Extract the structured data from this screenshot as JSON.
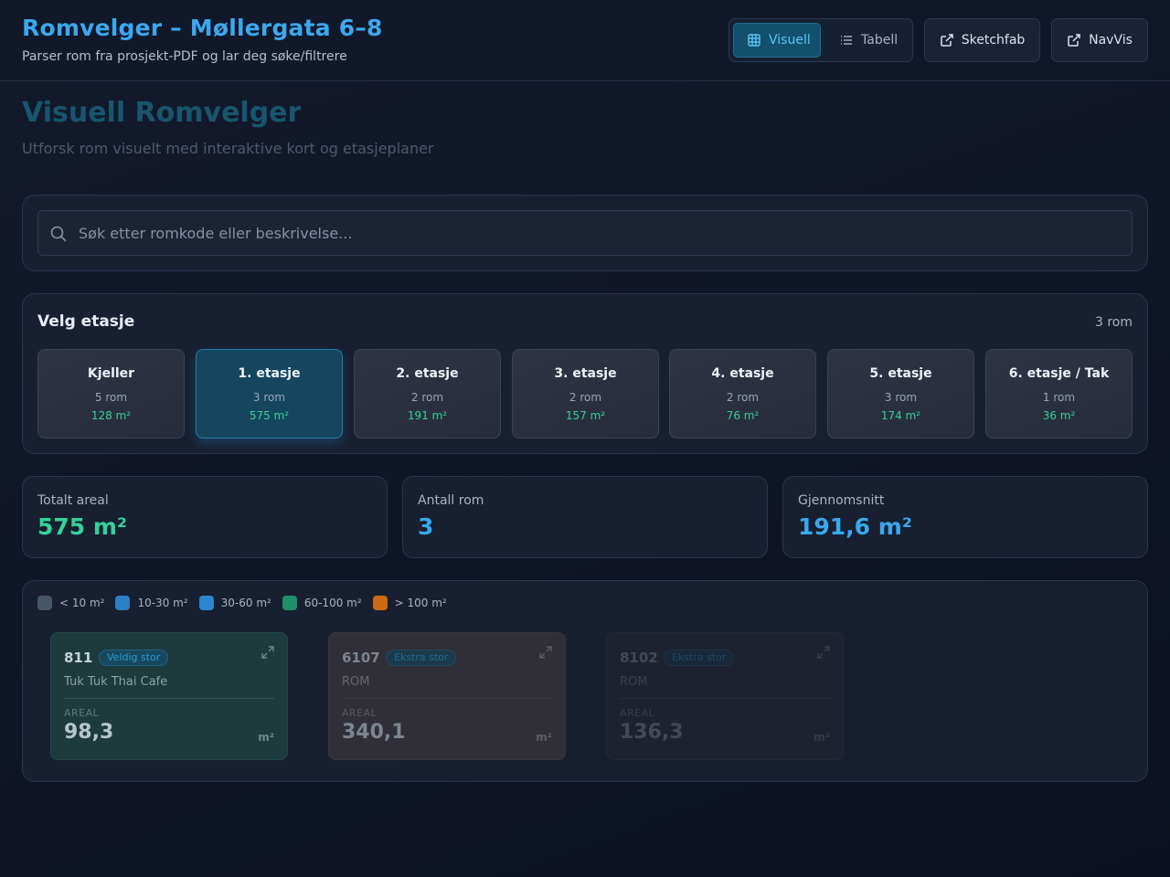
{
  "header": {
    "title": "Romvelger – Møllergata 6–8",
    "subtitle": "Parser rom fra prosjekt-PDF og lar deg søke/filtrere",
    "view_toggle": {
      "visual_label": "Visuell",
      "table_label": "Tabell"
    },
    "sketchfab_label": "Sketchfab",
    "navvis_label": "NavVis"
  },
  "page": {
    "title": "Visuell Romvelger",
    "subtitle": "Utforsk rom visuelt med interaktive kort og etasjeplaner"
  },
  "search": {
    "placeholder": "Søk etter romkode eller beskrivelse..."
  },
  "floor_selector": {
    "heading": "Velg etasje",
    "count": "3 rom",
    "floors": [
      {
        "name": "Kjeller",
        "rooms": "5 rom",
        "area": "128 m²",
        "active": false
      },
      {
        "name": "1. etasje",
        "rooms": "3 rom",
        "area": "575 m²",
        "active": true
      },
      {
        "name": "2. etasje",
        "rooms": "2 rom",
        "area": "191 m²",
        "active": false
      },
      {
        "name": "3. etasje",
        "rooms": "2 rom",
        "area": "157 m²",
        "active": false
      },
      {
        "name": "4. etasje",
        "rooms": "2 rom",
        "area": "76 m²",
        "active": false
      },
      {
        "name": "5. etasje",
        "rooms": "3 rom",
        "area": "174 m²",
        "active": false
      },
      {
        "name": "6. etasje / Tak",
        "rooms": "1 rom",
        "area": "36 m²",
        "active": false
      }
    ]
  },
  "stats": [
    {
      "label": "Totalt areal",
      "value": "575 m²",
      "color": "#34d399"
    },
    {
      "label": "Antall rom",
      "value": "3",
      "color": "#38a8f0"
    },
    {
      "label": "Gjennomsnitt",
      "value": "191,6 m²",
      "color": "#38a8f0"
    }
  ],
  "legend": [
    {
      "label": "< 10 m²",
      "color": "#475569"
    },
    {
      "label": "10-30 m²",
      "color": "#2b7fc4"
    },
    {
      "label": "30-60 m²",
      "color": "#2b86d0"
    },
    {
      "label": "60-100 m²",
      "color": "#1f8f6a"
    },
    {
      "label": "> 100 m²",
      "color": "#cc6a12"
    }
  ],
  "rooms": [
    {
      "code": "811",
      "badge": "Veldig stor",
      "description": "Tuk Tuk Thai Cafe",
      "area_label": "AREAL",
      "area": "98,3",
      "unit": "m²"
    },
    {
      "code": "6107",
      "badge": "Ekstra stor",
      "description": "ROM",
      "area_label": "AREAL",
      "area": "340,1",
      "unit": "m²"
    },
    {
      "code": "8102",
      "badge": "Ekstra stor",
      "description": "ROM",
      "area_label": "AREAL",
      "area": "136,3",
      "unit": "m²"
    }
  ]
}
